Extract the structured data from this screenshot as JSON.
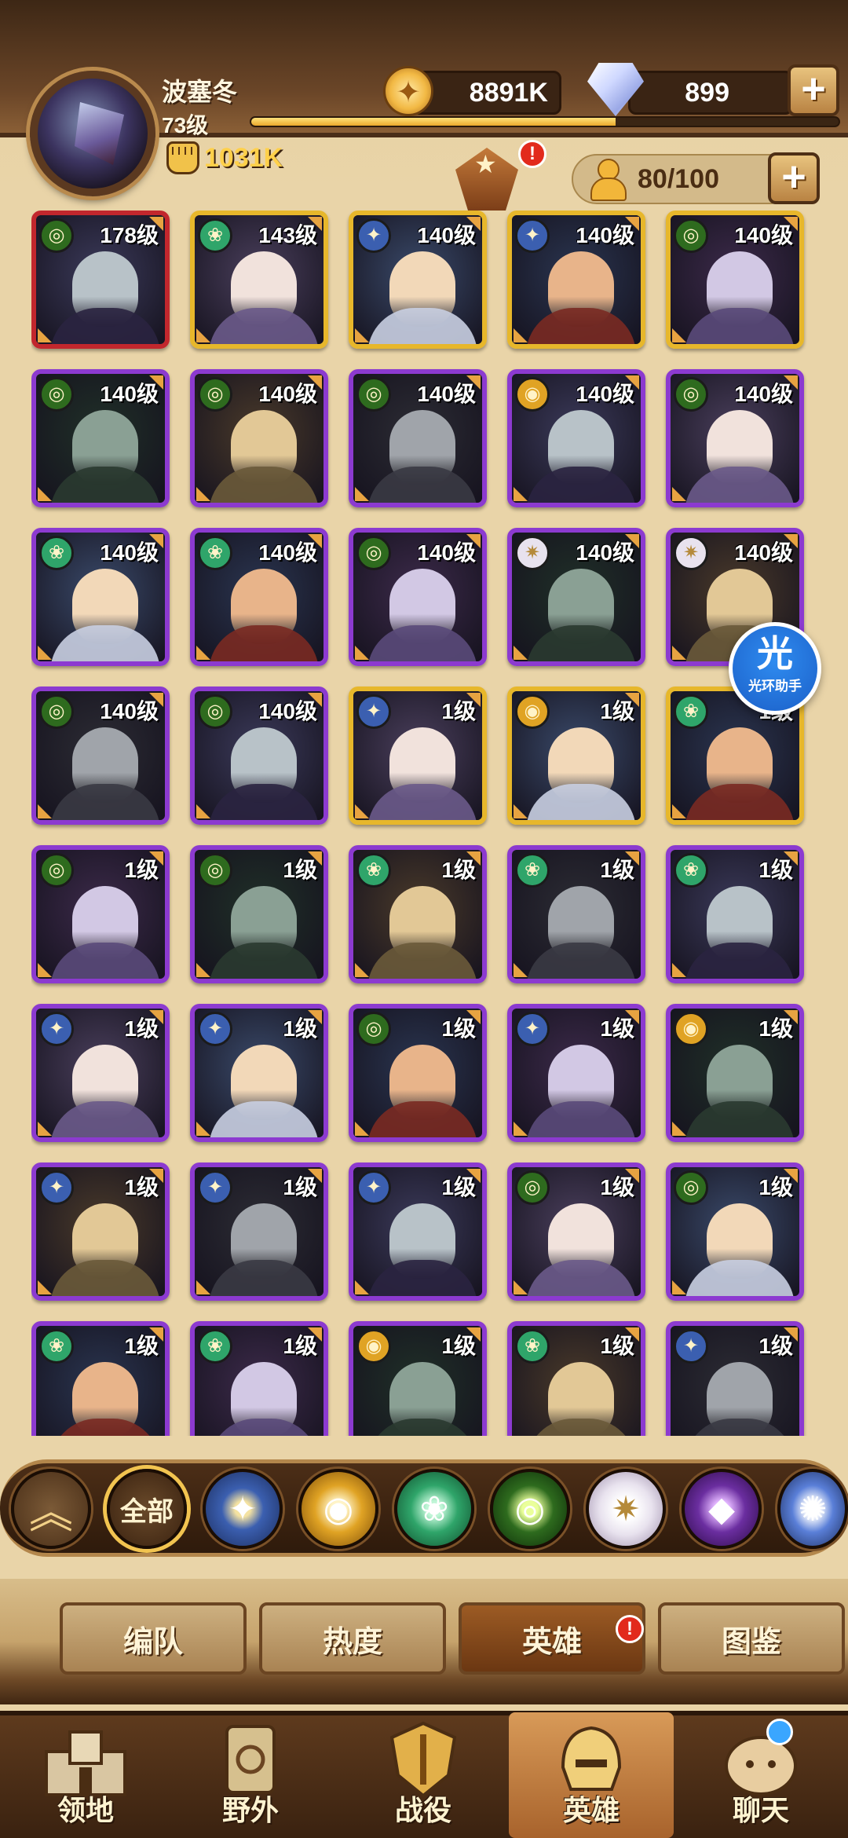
{
  "player": {
    "name": "波塞冬",
    "level": "73级",
    "power": "1031K",
    "xp_progress": 0.62
  },
  "resources": {
    "gold": "8891K",
    "gems": "899",
    "plus": "+"
  },
  "roster": {
    "capacity": "80/100",
    "event_badge": "!"
  },
  "heroes": [
    {
      "level": "178级",
      "faction": "mauler",
      "rarity": "red"
    },
    {
      "level": "143级",
      "faction": "wilder",
      "rarity": "gold"
    },
    {
      "level": "140级",
      "faction": "lightbearer",
      "rarity": "gold"
    },
    {
      "level": "140级",
      "faction": "lightbearer",
      "rarity": "gold"
    },
    {
      "level": "140级",
      "faction": "mauler",
      "rarity": "gold"
    },
    {
      "level": "140级",
      "faction": "mauler",
      "rarity": "purple"
    },
    {
      "level": "140级",
      "faction": "mauler",
      "rarity": "purple"
    },
    {
      "level": "140级",
      "faction": "mauler",
      "rarity": "purple"
    },
    {
      "level": "140级",
      "faction": "graveborn",
      "rarity": "purple"
    },
    {
      "level": "140级",
      "faction": "mauler",
      "rarity": "purple"
    },
    {
      "level": "140级",
      "faction": "wilder",
      "rarity": "purple"
    },
    {
      "level": "140级",
      "faction": "wilder",
      "rarity": "purple"
    },
    {
      "level": "140级",
      "faction": "mauler",
      "rarity": "purple"
    },
    {
      "level": "140级",
      "faction": "celestial",
      "rarity": "purple"
    },
    {
      "level": "140级",
      "faction": "celestial",
      "rarity": "purple"
    },
    {
      "level": "140级",
      "faction": "mauler",
      "rarity": "purple"
    },
    {
      "level": "140级",
      "faction": "mauler",
      "rarity": "purple"
    },
    {
      "level": "1级",
      "faction": "lightbearer",
      "rarity": "gold"
    },
    {
      "level": "1级",
      "faction": "graveborn",
      "rarity": "gold"
    },
    {
      "level": "1级",
      "faction": "wilder",
      "rarity": "gold"
    },
    {
      "level": "1级",
      "faction": "mauler",
      "rarity": "purple"
    },
    {
      "level": "1级",
      "faction": "mauler",
      "rarity": "purple"
    },
    {
      "level": "1级",
      "faction": "wilder",
      "rarity": "purple"
    },
    {
      "level": "1级",
      "faction": "wilder",
      "rarity": "purple"
    },
    {
      "level": "1级",
      "faction": "wilder",
      "rarity": "purple"
    },
    {
      "level": "1级",
      "faction": "lightbearer",
      "rarity": "purple"
    },
    {
      "level": "1级",
      "faction": "lightbearer",
      "rarity": "purple"
    },
    {
      "level": "1级",
      "faction": "mauler",
      "rarity": "purple"
    },
    {
      "level": "1级",
      "faction": "lightbearer",
      "rarity": "purple"
    },
    {
      "level": "1级",
      "faction": "graveborn",
      "rarity": "purple"
    },
    {
      "level": "1级",
      "faction": "lightbearer",
      "rarity": "purple"
    },
    {
      "level": "1级",
      "faction": "lightbearer",
      "rarity": "purple"
    },
    {
      "level": "1级",
      "faction": "lightbearer",
      "rarity": "purple"
    },
    {
      "level": "1级",
      "faction": "mauler",
      "rarity": "purple"
    },
    {
      "level": "1级",
      "faction": "mauler",
      "rarity": "purple"
    },
    {
      "level": "1级",
      "faction": "wilder",
      "rarity": "purple"
    },
    {
      "level": "1级",
      "faction": "wilder",
      "rarity": "purple"
    },
    {
      "level": "1级",
      "faction": "graveborn",
      "rarity": "purple"
    },
    {
      "level": "1级",
      "faction": "wilder",
      "rarity": "purple"
    },
    {
      "level": "1级",
      "faction": "lightbearer",
      "rarity": "purple"
    }
  ],
  "helper": {
    "char": "光",
    "label": "光环助手"
  },
  "filters": {
    "all_label": "全部",
    "icons": [
      "collapse-arrows",
      "lightbearer",
      "graveborn",
      "wilder",
      "mauler",
      "celestial",
      "hypogean",
      "dimensional"
    ]
  },
  "subtabs": [
    "编队",
    "热度",
    "英雄",
    "图鉴"
  ],
  "subtab_badge": "!",
  "nav": [
    "领地",
    "野外",
    "战役",
    "英雄",
    "聊天"
  ],
  "colors": {
    "lightbearer": "#3b5fb0",
    "graveborn": "#e0a324",
    "wilder": "#2fa56a",
    "mauler": "#2e6b1e",
    "celestial": "#e8e2ee",
    "hypogean": "#6b2ea0",
    "dimensional": "#5a7fd8",
    "rarity_gold": "#e7b72b",
    "rarity_purple": "#8c3ad0",
    "rarity_red": "#c2272d"
  }
}
